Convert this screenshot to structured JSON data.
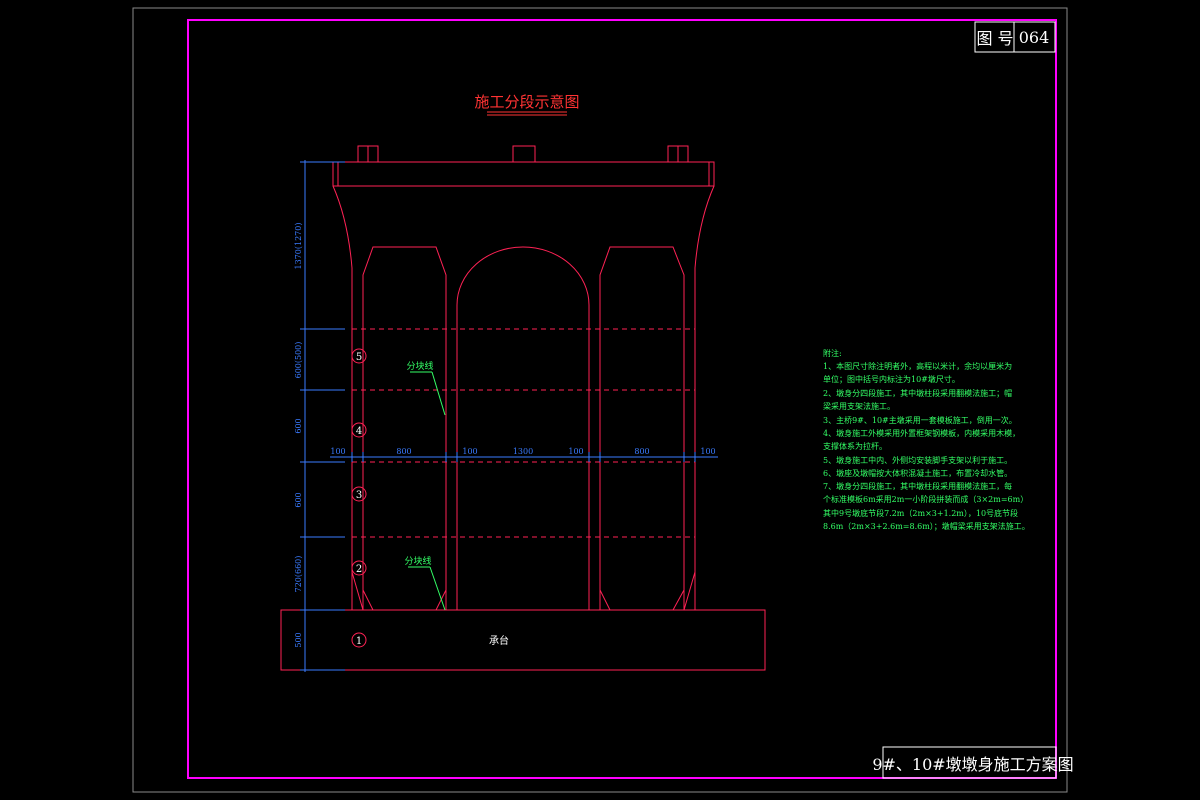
{
  "drawing_number": {
    "label": "图 号",
    "value": "064"
  },
  "diagram_title": "施工分段示意图",
  "sheet_title": "9#、10#墩墩身施工方案图",
  "segments": [
    {
      "number": "1",
      "label": "承台"
    },
    {
      "number": "2"
    },
    {
      "number": "3"
    },
    {
      "number": "4"
    },
    {
      "number": "5"
    }
  ],
  "split_line_label": "分块线",
  "vertical_dimensions": [
    "1370(1270)",
    "600(500)",
    "600",
    "600",
    "720(660)",
    "500"
  ],
  "horizontal_dimensions": [
    "100",
    "800",
    "100",
    "1300",
    "100",
    "800",
    "100"
  ],
  "notes": {
    "heading": "附注:",
    "lines": [
      "1、本图尺寸除注明者外，高程以米计，余均以厘米为",
      "   单位；图中括号内标注为10#墩尺寸。",
      "2、墩身分四段施工，其中墩柱段采用翻模法施工；帽",
      "   梁采用支架法施工。",
      "3、主桥9#、10#主墩采用一套模板施工，倒用一次。",
      "4、墩身施工外模采用外置框架钢模板，内模采用木模，",
      "   支撑体系为拉杆。",
      "5、墩身施工中内、外侧均安装脚手支架以利于施工。",
      "6、墩座及墩帽按大体积混凝土施工，布置冷却水管。",
      "7、墩身分四段施工，其中墩柱段采用翻模法施工，每",
      "   个标准模板6m采用2m一小阶段拼装而成（3×2m=6m）",
      "   其中9号墩底节段7.2m（2m×3+1.2m），10号底节段",
      "   8.6m（2m×3+2.6m=8.6m）；墩帽梁采用支架法施工。"
    ]
  },
  "colors": {
    "background": "#000000",
    "frame_outer": "#8a8a8a",
    "frame_inner": "#ff00ff",
    "structure": "#ff2255",
    "dimension": "#3a7bff",
    "text_white": "#ffffff",
    "text_green": "#33ff66",
    "title_red": "#ff3333"
  }
}
